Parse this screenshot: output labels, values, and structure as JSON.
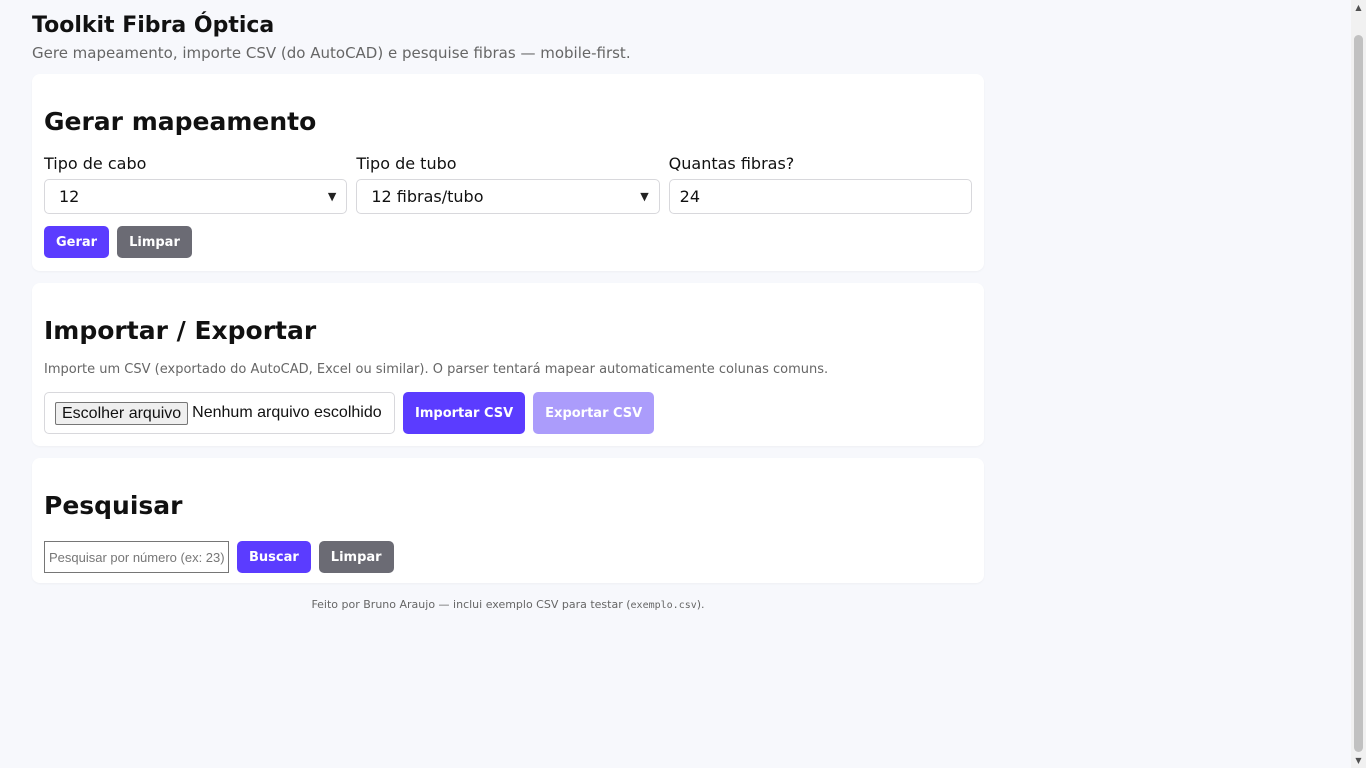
{
  "header": {
    "title": "Toolkit Fibra Óptica",
    "subtitle": "Gere mapeamento, importe CSV (do AutoCAD) e pesquise fibras — mobile-first."
  },
  "generate": {
    "heading": "Gerar mapeamento",
    "cable_label": "Tipo de cabo",
    "cable_value": "12",
    "tube_label": "Tipo de tubo",
    "tube_value": "12 fibras/tubo",
    "count_label": "Quantas fibras?",
    "count_value": "24",
    "generate_btn": "Gerar",
    "clear_btn": "Limpar"
  },
  "import_export": {
    "heading": "Importar / Exportar",
    "description": "Importe um CSV (exportado do AutoCAD, Excel ou similar). O parser tentará mapear automaticamente colunas comuns.",
    "file_button": "Escolher arquivo",
    "file_status": "Nenhum arquivo escolhido",
    "import_btn": "Importar CSV",
    "export_btn": "Exportar CSV"
  },
  "search": {
    "heading": "Pesquisar",
    "placeholder": "Pesquisar por número (ex: 23)",
    "search_btn": "Buscar",
    "clear_btn": "Limpar"
  },
  "footer": {
    "text": "Feito por Bruno Araujo — inclui exemplo CSV para testar (",
    "code": "exemplo.csv",
    "text_end": ")."
  },
  "icons": {
    "select_chevron": "chevron-down-icon",
    "scroll_up": "arrow-up-icon",
    "scroll_down": "arrow-down-icon"
  },
  "colors": {
    "primary": "#5b3cff",
    "secondary": "#6b6b74",
    "disabled": "#ab9cfb",
    "background": "#f7f8fc"
  }
}
